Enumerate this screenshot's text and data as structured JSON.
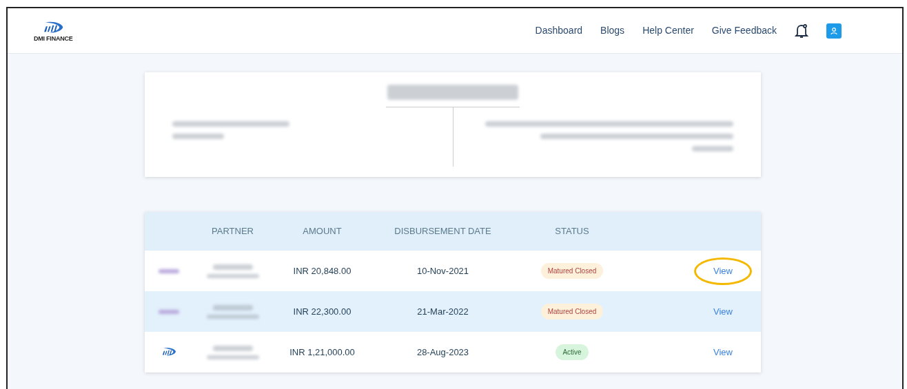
{
  "brand": {
    "name": "DMI FINANCE"
  },
  "nav": [
    {
      "label": "Dashboard"
    },
    {
      "label": "Blogs"
    },
    {
      "label": "Help Center"
    },
    {
      "label": "Give Feedback"
    }
  ],
  "table": {
    "columns": [
      "PARTNER",
      "AMOUNT",
      "DISBURSEMENT DATE",
      "STATUS"
    ],
    "rows": [
      {
        "logo": {
          "kind": "blurred"
        },
        "amount": "INR 20,848.00",
        "date": "10-Nov-2021",
        "status": {
          "label": "Matured Closed",
          "kind": "closed"
        },
        "action": "View",
        "highlighted": false,
        "circled": true
      },
      {
        "logo": {
          "kind": "blurred"
        },
        "amount": "INR 22,300.00",
        "date": "21-Mar-2022",
        "status": {
          "label": "Matured Closed",
          "kind": "closed"
        },
        "action": "View",
        "highlighted": true,
        "circled": false
      },
      {
        "logo": {
          "kind": "brand"
        },
        "amount": "INR 1,21,000.00",
        "date": "28-Aug-2023",
        "status": {
          "label": "Active",
          "kind": "active"
        },
        "action": "View",
        "highlighted": false,
        "circled": false
      }
    ]
  }
}
